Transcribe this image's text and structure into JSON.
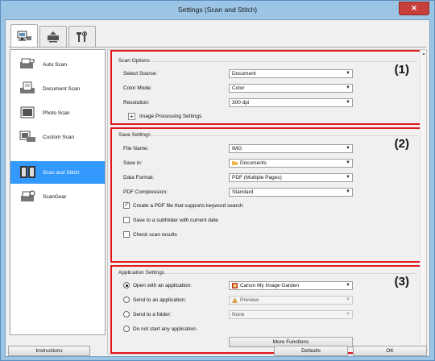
{
  "window": {
    "title": "Settings (Scan and Stitch)",
    "close_glyph": "✕"
  },
  "tabs": [
    {
      "name": "scan-from-computer-tab-icon",
      "active": true
    },
    {
      "name": "scan-from-operation-panel-tab-icon",
      "active": false
    },
    {
      "name": "general-settings-tab-icon",
      "active": false
    }
  ],
  "nav": {
    "items": [
      {
        "label": "Auto Scan",
        "icon": "auto-scan-icon"
      },
      {
        "label": "Document Scan",
        "icon": "document-scan-icon"
      },
      {
        "label": "Photo Scan",
        "icon": "photo-scan-icon"
      },
      {
        "label": "Custom Scan",
        "icon": "custom-scan-icon"
      },
      {
        "label": "Scan and Stitch",
        "icon": "scan-and-stitch-icon",
        "selected": true
      },
      {
        "label": "ScanGear",
        "icon": "scangear-icon"
      }
    ]
  },
  "scan_options": {
    "title": "Scan Options",
    "number": "(1)",
    "select_source": {
      "label": "Select Source:",
      "value": "Document"
    },
    "color_mode": {
      "label": "Color Mode:",
      "value": "Color"
    },
    "resolution": {
      "label": "Resolution:",
      "value": "300 dpi"
    },
    "image_processing": {
      "label": "Image Processing Settings",
      "toggle": "+"
    }
  },
  "save_settings": {
    "title": "Save Settings",
    "number": "(2)",
    "file_name": {
      "label": "File Name:",
      "value": "IMG"
    },
    "save_in": {
      "label": "Save in:",
      "value": "Documents"
    },
    "data_format": {
      "label": "Data Format:",
      "value": "PDF (Multiple Pages)"
    },
    "pdf_compression": {
      "label": "PDF Compression:",
      "value": "Standard"
    },
    "check_keyword": {
      "label": "Create a PDF file that supports keyword search",
      "checked": true,
      "mark": "✓"
    },
    "check_subfolder": {
      "label": "Save to a subfolder with current date",
      "checked": false
    },
    "check_results": {
      "label": "Check scan results",
      "checked": false
    }
  },
  "app_settings": {
    "title": "Application Settings",
    "number": "(3)",
    "open_with": {
      "label": "Open with an application:",
      "value": "Canon My Image Garden",
      "selected": true
    },
    "send_app": {
      "label": "Send to an application:",
      "value": "Preview",
      "selected": false
    },
    "send_folder": {
      "label": "Send to a folder:",
      "value": "None",
      "selected": false
    },
    "no_app": {
      "label": "Do not start any application",
      "selected": false
    },
    "more_functions": "More Functions"
  },
  "footer": {
    "instructions": "Instructions",
    "defaults": "Defaults",
    "ok": "OK"
  },
  "colors": {
    "highlight": "#e3161d",
    "selected_nav": "#3399ff"
  }
}
